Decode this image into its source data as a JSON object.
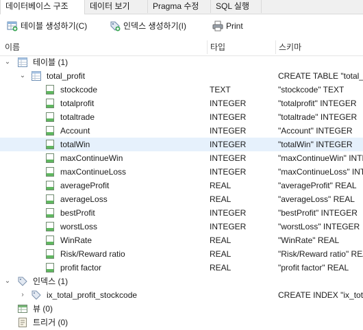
{
  "tabs": [
    {
      "label": "데이터베이스 구조",
      "active": true
    },
    {
      "label": "데이터 보기",
      "active": false
    },
    {
      "label": "Pragma 수정",
      "active": false
    },
    {
      "label": "SQL 실행",
      "active": false
    }
  ],
  "toolbar": {
    "create_table": "테이블 생성하기(C)",
    "create_index": "인덱스 생성하기(I)",
    "print": "Print"
  },
  "columns": {
    "name": "이름",
    "type": "타입",
    "schema": "스키마"
  },
  "tree": {
    "tables_group": "테이블 (1)",
    "table": {
      "name": "total_profit",
      "schema": "CREATE TABLE \"total_profit\""
    },
    "fields": [
      {
        "name": "stockcode",
        "type": "TEXT",
        "schema": "\"stockcode\" TEXT"
      },
      {
        "name": "totalprofit",
        "type": "INTEGER",
        "schema": "\"totalprofit\" INTEGER"
      },
      {
        "name": "totaltrade",
        "type": "INTEGER",
        "schema": "\"totaltrade\" INTEGER"
      },
      {
        "name": "Account",
        "type": "INTEGER",
        "schema": "\"Account\" INTEGER"
      },
      {
        "name": "totalWin",
        "type": "INTEGER",
        "schema": "\"totalWin\" INTEGER"
      },
      {
        "name": "maxContinueWin",
        "type": "INTEGER",
        "schema": "\"maxContinueWin\" INTEGER"
      },
      {
        "name": "maxContinueLoss",
        "type": "INTEGER",
        "schema": "\"maxContinueLoss\" INTEGER"
      },
      {
        "name": "averageProfit",
        "type": "REAL",
        "schema": "\"averageProfit\" REAL"
      },
      {
        "name": "averageLoss",
        "type": "REAL",
        "schema": "\"averageLoss\" REAL"
      },
      {
        "name": "bestProfit",
        "type": "INTEGER",
        "schema": "\"bestProfit\" INTEGER"
      },
      {
        "name": "worstLoss",
        "type": "INTEGER",
        "schema": "\"worstLoss\" INTEGER"
      },
      {
        "name": "WinRate",
        "type": "REAL",
        "schema": "\"WinRate\" REAL"
      },
      {
        "name": "Risk/Reward ratio",
        "type": "REAL",
        "schema": "\"Risk/Reward ratio\" REAL"
      },
      {
        "name": "profit factor",
        "type": "REAL",
        "schema": "\"profit factor\" REAL"
      }
    ],
    "selected_field": "totalWin",
    "indexes_group": "인덱스 (1)",
    "index": {
      "name": "ix_total_profit_stockcode",
      "schema": "CREATE INDEX \"ix_total_profit_stockcode\""
    },
    "views_group": "뷰 (0)",
    "triggers_group": "트리거 (0)"
  },
  "icons": {
    "create_table": "table-add-icon",
    "create_index": "index-add-icon",
    "print": "printer-icon",
    "table": "table-icon",
    "field": "field-icon",
    "index": "index-tag-icon",
    "view": "view-icon",
    "trigger": "trigger-icon"
  }
}
